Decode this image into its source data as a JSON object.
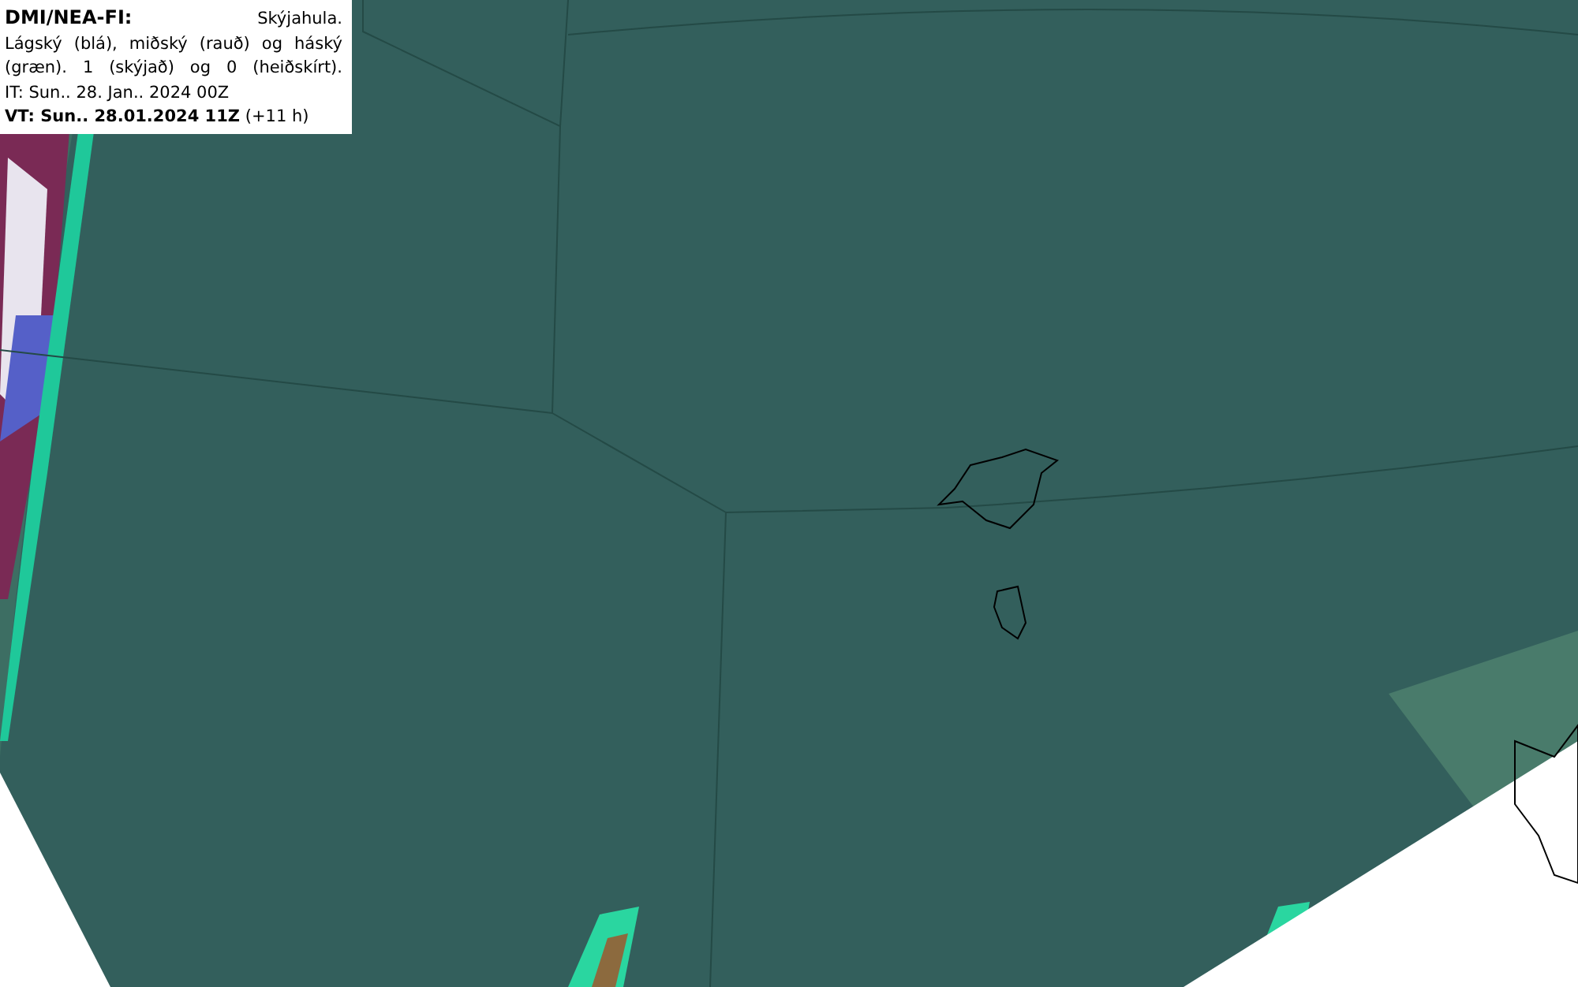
{
  "legend": {
    "source": "DMI/NEA-FI:",
    "title": "Skýjahula.",
    "description": "Lágský (blá), miðský (rauð) og háský (græn). 1 (skýjað) og 0 (heiðskírt).",
    "issue_time": "IT: Sun.. 28. Jan.. 2024 00Z",
    "valid_time": "**VT: Sun.. 28.01.2024 11Z** (+11 h)"
  }
}
